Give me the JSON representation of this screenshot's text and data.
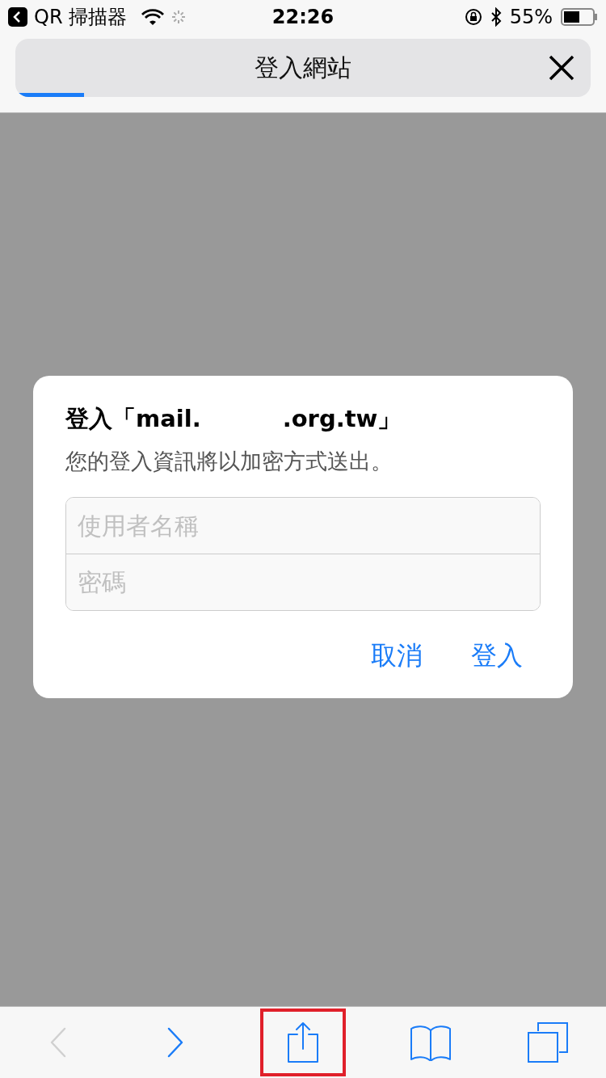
{
  "status_bar": {
    "back_app": "QR 掃描器",
    "time": "22:26",
    "battery": "55%"
  },
  "nav": {
    "title": "登入網站",
    "level": 0.12
  },
  "dialog": {
    "title": "登入「mail.          .org.tw」",
    "message": "您的登入資訊將以加密方式送出。",
    "fields": [
      {
        "placeholder": "使用者名稱"
      },
      {
        "placeholder": "密碼"
      }
    ],
    "buttons": [
      {
        "label": "取消"
      },
      {
        "label": "登入"
      }
    ]
  },
  "toolbar": [
    {
      "kind": "back",
      "disabled": true,
      "highlighted": false
    },
    {
      "kind": "forward",
      "disabled": false,
      "highlighted": false
    },
    {
      "kind": "share",
      "disabled": false,
      "highlighted": true
    },
    {
      "kind": "bookmarks",
      "disabled": false,
      "highlighted": false
    },
    {
      "kind": "tabs",
      "disabled": false,
      "highlighted": false
    }
  ]
}
